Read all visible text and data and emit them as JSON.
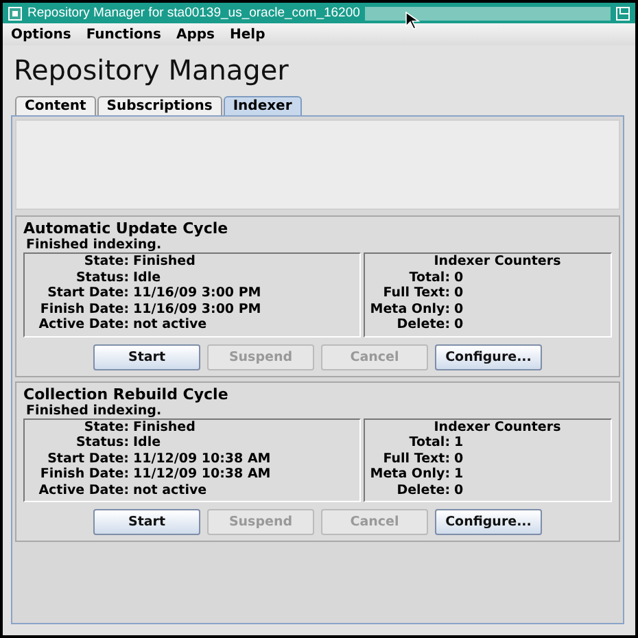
{
  "window": {
    "title": "Repository Manager for sta00139_us_oracle_com_16200"
  },
  "menu": [
    "Options",
    "Functions",
    "Apps",
    "Help"
  ],
  "heading": "Repository Manager",
  "tabs": [
    {
      "label": "Content",
      "selected": false
    },
    {
      "label": "Subscriptions",
      "selected": false
    },
    {
      "label": "Indexer",
      "selected": true
    }
  ],
  "sections": [
    {
      "title": "Automatic Update Cycle",
      "message": "Finished indexing.",
      "fields": [
        {
          "label": "State:",
          "value": "Finished"
        },
        {
          "label": "Status:",
          "value": "Idle"
        },
        {
          "label": "Start Date:",
          "value": "11/16/09 3:00 PM"
        },
        {
          "label": "Finish Date:",
          "value": "11/16/09 3:00 PM"
        },
        {
          "label": "Active Date:",
          "value": "not active"
        }
      ],
      "counters_title": "Indexer Counters",
      "counters": [
        {
          "label": "Total:",
          "value": "0"
        },
        {
          "label": "Full Text:",
          "value": "0"
        },
        {
          "label": "Meta Only:",
          "value": "0"
        },
        {
          "label": "Delete:",
          "value": "0"
        }
      ],
      "buttons": [
        {
          "label": "Start",
          "disabled": false
        },
        {
          "label": "Suspend",
          "disabled": true
        },
        {
          "label": "Cancel",
          "disabled": true
        },
        {
          "label": "Configure...",
          "disabled": false
        }
      ]
    },
    {
      "title": "Collection Rebuild Cycle",
      "message": "Finished indexing.",
      "fields": [
        {
          "label": "State:",
          "value": "Finished"
        },
        {
          "label": "Status:",
          "value": "Idle"
        },
        {
          "label": "Start Date:",
          "value": "11/12/09 10:38 AM"
        },
        {
          "label": "Finish Date:",
          "value": "11/12/09 10:38 AM"
        },
        {
          "label": "Active Date:",
          "value": "not active"
        }
      ],
      "counters_title": "Indexer Counters",
      "counters": [
        {
          "label": "Total:",
          "value": "1"
        },
        {
          "label": "Full Text:",
          "value": "0"
        },
        {
          "label": "Meta Only:",
          "value": "1"
        },
        {
          "label": "Delete:",
          "value": "0"
        }
      ],
      "buttons": [
        {
          "label": "Start",
          "disabled": false
        },
        {
          "label": "Suspend",
          "disabled": true
        },
        {
          "label": "Cancel",
          "disabled": true
        },
        {
          "label": "Configure...",
          "disabled": false
        }
      ]
    }
  ]
}
